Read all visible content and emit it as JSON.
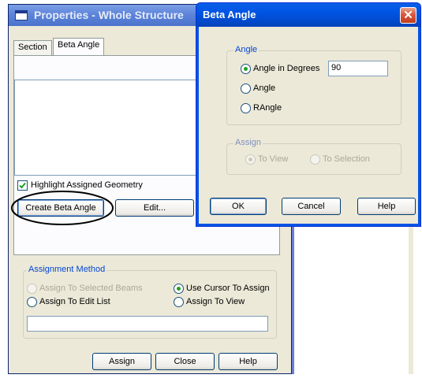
{
  "properties_window": {
    "title": "Properties - Whole Structure",
    "tabs": [
      "Section",
      "Beta Angle"
    ],
    "highlight_label": "Highlight Assigned Geometry",
    "highlight_checked": true,
    "create_button": "Create Beta Angle",
    "edit_button": "Edit...",
    "assignment_group": "Assignment Method",
    "radio_selected_beams": "Assign To Selected Beams",
    "radio_cursor": "Use Cursor To Assign",
    "radio_edit_list": "Assign To Edit List",
    "radio_view": "Assign To View",
    "assign_button": "Assign",
    "close_button": "Close",
    "help_button": "Help"
  },
  "beta_dialog": {
    "title": "Beta Angle",
    "close_glyph": "✕",
    "angle_group": "Angle",
    "opt_degrees": "Angle in Degrees",
    "degrees_value": "90",
    "opt_angle": "Angle",
    "opt_rangle": "RAngle",
    "assign_group": "Assign",
    "opt_to_view": "To View",
    "opt_to_selection": "To Selection",
    "ok_button": "OK",
    "cancel_button": "Cancel",
    "help_button": "Help"
  }
}
